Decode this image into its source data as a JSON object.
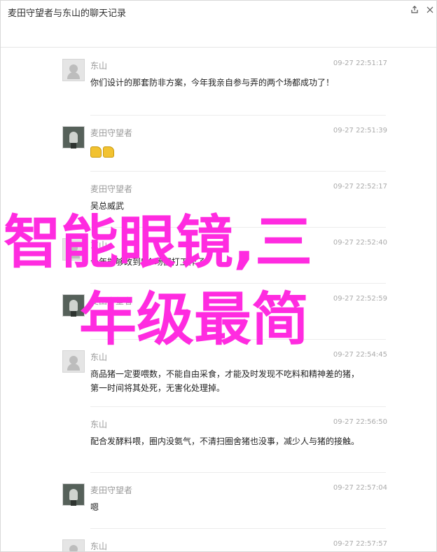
{
  "window": {
    "title": "麦田守望者与东山的聊天记录"
  },
  "messages": [
    {
      "sender": "东山",
      "time": "09-27 22:51:17",
      "text": "你们设计的那套防非方案，今年我亲自参与弄的两个场都成功了！",
      "avatar": "plain"
    },
    {
      "sender": "麦田守望者",
      "time": "09-27 22:51:39",
      "text": "",
      "emoji": "thumbs-up-icon",
      "avatar": "photo"
    },
    {
      "sender": "麦田守望者",
      "time": "09-27 22:52:17",
      "text": "吴总威武",
      "avatar": "none"
    },
    {
      "sender": "东山",
      "time": "09-27 22:52:40",
      "text": "今年能够改到5个场都打工作了",
      "avatar": "plain"
    },
    {
      "sender": "麦田守望者",
      "time": "09-27 22:52:59",
      "text": "",
      "avatar": "photo"
    },
    {
      "sender": "东山",
      "time": "09-27 22:54:45",
      "text": "商品猪一定要喂数，不能自由采食，才能及时发现不吃料和精神差的猪，第一时间将其处死，无害化处理掉。",
      "avatar": "plain"
    },
    {
      "sender": "东山",
      "time": "09-27 22:56:50",
      "text": "配合发酵料喂，圈内没氨气，不清扫圈舍猪也没事，减少人与猪的接触。",
      "avatar": "none"
    },
    {
      "sender": "麦田守望者",
      "time": "09-27 22:57:04",
      "text": "嗯",
      "avatar": "photo"
    },
    {
      "sender": "东山",
      "time": "09-27 22:57:57",
      "text": "",
      "avatar": "plain"
    }
  ],
  "overlay": {
    "line1": "智能眼镜,三",
    "line2": "年级最简"
  }
}
